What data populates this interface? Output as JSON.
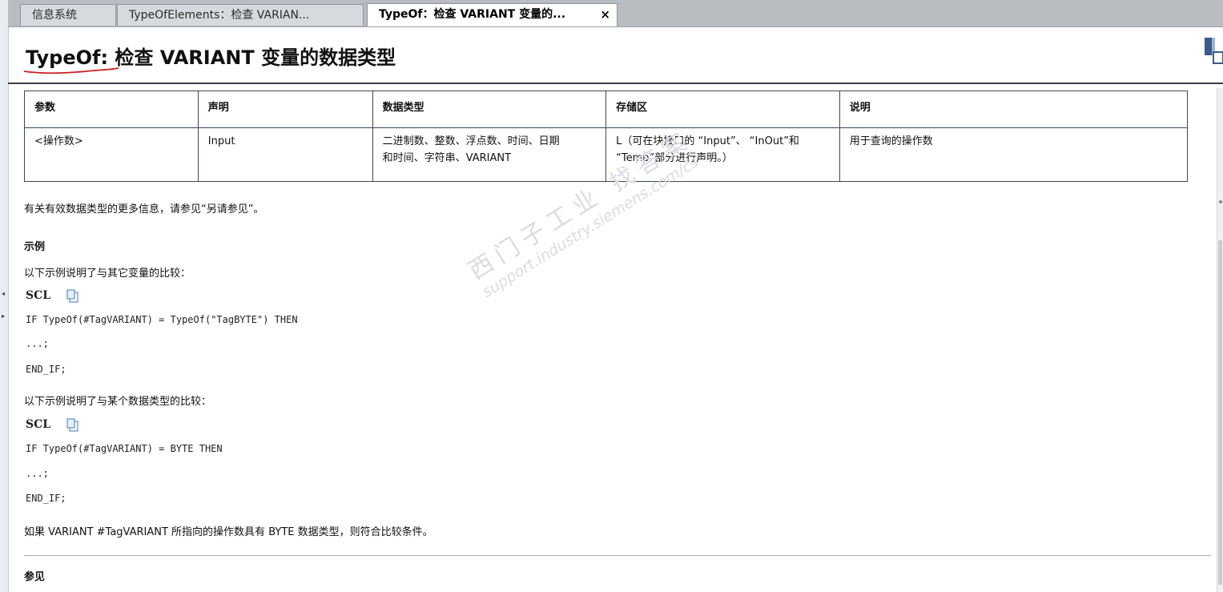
{
  "tabs": [
    {
      "label": "信息系统"
    },
    {
      "label": "TypeOfElements：检查 VARIAN..."
    },
    {
      "label": "TypeOf：检查 VARIANT 变量的...",
      "close": "×"
    }
  ],
  "title": "TypeOf:  检查 VARIANT 变量的数据类型",
  "table": {
    "headers": [
      "参数",
      "声明",
      "数据类型",
      "存储区",
      "说明"
    ],
    "row": {
      "param": "<操作数>",
      "decl": "Input",
      "type_line1": "二进制数、整数、浮点数、时间、日期",
      "type_line2": "和时间、字符串、VARIANT",
      "area_line1": "L（可在块接口的 “Input”、 “InOut”和",
      "area_line2": "“Temp”部分进行声明。）",
      "desc": "用于查询的操作数"
    }
  },
  "info_text": "有关有效数据类型的更多信息，请参见“另请参见”。",
  "example_heading": "示例",
  "example1": {
    "intro": "以下示例说明了与其它变量的比较：",
    "lang": "SCL",
    "line1": "IF TypeOf(#TagVARIANT) = TypeOf(\"TagBYTE\") THEN",
    "line2": "...;",
    "line3": "END_IF;"
  },
  "example2": {
    "intro": "以下示例说明了与某个数据类型的比较：",
    "lang": "SCL",
    "line1": "IF TypeOf(#TagVARIANT) = BYTE THEN",
    "line2": "...;",
    "line3": "END_IF;"
  },
  "condition_text": "如果 VARIANT #TagVARIANT 所指向的操作数具有 BYTE 数据类型，则符合比较条件。",
  "see_also_heading": "参见",
  "watermark": {
    "line1": "西门子工业 找答案",
    "line2": "support.industry.siemens.com/cs"
  },
  "icons": {
    "copy": "copy-icon",
    "corner": "window-layout-icon"
  },
  "colors": {
    "tabbar": "#b9bcc1",
    "rule": "#3a3f47",
    "accent_squiggle": "#cc1f1f"
  }
}
